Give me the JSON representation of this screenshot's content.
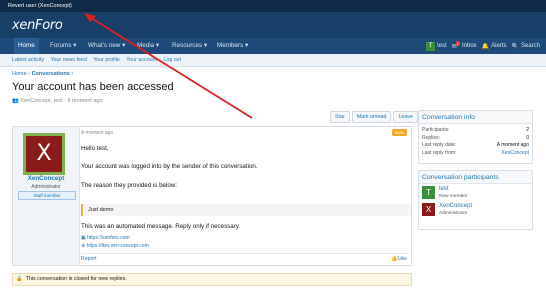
{
  "topbar": {
    "text": "Revert user (XenConcept)"
  },
  "header": {
    "logo": "xenForo"
  },
  "nav": {
    "items": [
      {
        "label": "Home"
      },
      {
        "label": "Forums ▾"
      },
      {
        "label": "What's new ▾"
      },
      {
        "label": "Media ▾"
      },
      {
        "label": "Resources ▾"
      },
      {
        "label": "Members ▾"
      }
    ],
    "user": {
      "initial": "T",
      "name": "test"
    },
    "inbox": "Inbox",
    "alerts": "Alerts",
    "search": "Search"
  },
  "subnav": {
    "items": [
      {
        "label": "Latest activity"
      },
      {
        "label": "Your news feed"
      },
      {
        "label": "Your profile"
      },
      {
        "label": "Your account"
      },
      {
        "label": "Log out"
      }
    ]
  },
  "breadcrumb": {
    "home": "Home",
    "sep": "›",
    "section": "Conversations"
  },
  "page": {
    "title": "Your account has been accessed",
    "meta": "XenConcept, test · 6 moment ago"
  },
  "actions": {
    "star": "Star",
    "mark_unread": "Mark unread",
    "leave": "Leave"
  },
  "message": {
    "author": "XenConcept",
    "author_initial": "X",
    "author_title": "Administrator",
    "staff_badge": "Staff member",
    "time": "A moment ago",
    "new_badge": "New",
    "greeting": "Hello test,",
    "line1": "Your account was logged into by the sender of this conversation.",
    "line2": "The reason they provided is below:",
    "quote": "Just demo",
    "line3": "This was an automated message. Reply only if necessary.",
    "link1": "https://xenforo.com",
    "link2": "https://dev.xen-concept.com",
    "report": "Report",
    "like": "Like"
  },
  "closed_notice": {
    "text": "This conversation is closed for new replies."
  },
  "info_panel": {
    "title": "Conversation info",
    "rows": [
      {
        "k": "Participants:",
        "v": "2"
      },
      {
        "k": "Replies:",
        "v": "0"
      },
      {
        "k": "Last reply date:",
        "v": "A moment ago"
      },
      {
        "k": "Last reply from:",
        "v": "XenConcept"
      }
    ]
  },
  "participants_panel": {
    "title": "Conversation participants",
    "list": [
      {
        "initial": "T",
        "name": "test",
        "title": "New member"
      },
      {
        "initial": "X",
        "name": "XenConcept",
        "title": "Administrator"
      }
    ]
  },
  "colors": {
    "header": "#183f67",
    "navbar": "#1d4a78",
    "link": "#2577b1",
    "annotation_arrow": "#e02020"
  }
}
